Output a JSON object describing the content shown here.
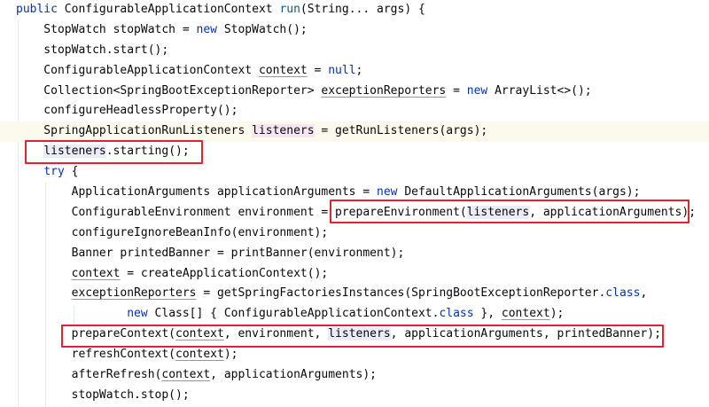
{
  "editor": {
    "current_line_index": 6,
    "lines": [
      [
        [
          "public ",
          "kw"
        ],
        [
          "ConfigurableApplicationContext ",
          ""
        ],
        [
          "run",
          "fn"
        ],
        [
          "(String... args) {",
          ""
        ]
      ],
      [
        [
          "    StopWatch stopWatch = ",
          ""
        ],
        [
          "new ",
          "kw"
        ],
        [
          "StopWatch();",
          ""
        ]
      ],
      [
        [
          "    stopWatch.start();",
          ""
        ]
      ],
      [
        [
          "    ConfigurableApplicationContext ",
          ""
        ],
        [
          "context",
          "ul"
        ],
        [
          " = ",
          ""
        ],
        [
          "null",
          "kw"
        ],
        [
          ";",
          ""
        ]
      ],
      [
        [
          "    Collection<SpringBootExceptionReporter> ",
          ""
        ],
        [
          "exceptionReporters",
          "ul"
        ],
        [
          " = ",
          ""
        ],
        [
          "new ",
          "kw"
        ],
        [
          "ArrayList<>();",
          ""
        ]
      ],
      [
        [
          "    configureHeadlessProperty();",
          ""
        ]
      ],
      [
        [
          "    SpringApplicationRunListeners ",
          ""
        ],
        [
          "listeners",
          "hw"
        ],
        [
          " = getRunListeners(args);",
          ""
        ]
      ],
      [
        [
          "    ",
          ""
        ],
        [
          "listeners",
          "hr"
        ],
        [
          ".starting();",
          ""
        ]
      ],
      [
        [
          "    ",
          ""
        ],
        [
          "try ",
          "kw"
        ],
        [
          "{",
          ""
        ]
      ],
      [
        [
          "        ApplicationArguments applicationArguments = ",
          ""
        ],
        [
          "new ",
          "kw"
        ],
        [
          "DefaultApplicationArguments(args);",
          ""
        ]
      ],
      [
        [
          "        ConfigurableEnvironment environment = prepareEnvironment(",
          ""
        ],
        [
          "listeners",
          "hr"
        ],
        [
          ", applicationArguments);",
          ""
        ]
      ],
      [
        [
          "        configureIgnoreBeanInfo(environment);",
          ""
        ]
      ],
      [
        [
          "        Banner printedBanner = printBanner(environment);",
          ""
        ]
      ],
      [
        [
          "        ",
          ""
        ],
        [
          "context",
          "ul"
        ],
        [
          " = createApplicationContext();",
          ""
        ]
      ],
      [
        [
          "        ",
          ""
        ],
        [
          "exceptionReporters",
          "ul"
        ],
        [
          " = getSpringFactoriesInstances(SpringBootExceptionReporter.",
          ""
        ],
        [
          "class",
          "kw"
        ],
        [
          ",",
          ""
        ]
      ],
      [
        [
          "                ",
          ""
        ],
        [
          "new ",
          "kw"
        ],
        [
          "Class[] { ConfigurableApplicationContext.",
          ""
        ],
        [
          "class ",
          "kw"
        ],
        [
          "}, ",
          ""
        ],
        [
          "context",
          "ul"
        ],
        [
          ");",
          ""
        ]
      ],
      [
        [
          "        prepareContext(",
          ""
        ],
        [
          "context",
          "ul"
        ],
        [
          ", environment, ",
          ""
        ],
        [
          "listeners",
          "hr"
        ],
        [
          ", applicationArguments, printedBanner);",
          ""
        ]
      ],
      [
        [
          "        refreshContext(",
          ""
        ],
        [
          "context",
          "ul"
        ],
        [
          ");",
          ""
        ]
      ],
      [
        [
          "        afterRefresh(",
          ""
        ],
        [
          "context",
          "ul"
        ],
        [
          ", applicationArguments);",
          ""
        ]
      ],
      [
        [
          "        stopWatch.stop();",
          ""
        ]
      ]
    ]
  },
  "annotations": {
    "color": "#e0242f",
    "boxes": [
      "listeners.starting()",
      "prepareEnvironment(listeners, applicationArguments)",
      "prepareContext(context, environment, listeners, applicationArguments, printedBanner)"
    ]
  }
}
